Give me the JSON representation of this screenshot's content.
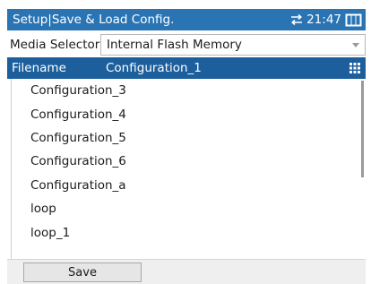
{
  "titlebar": {
    "title": "Setup|Save & Load Config.",
    "time": "21:47",
    "network_icon": "network-transfer-icon",
    "battery_icon": "battery-icon"
  },
  "media_selector": {
    "label": "Media Selector",
    "value": "Internal Flash Memory"
  },
  "filename": {
    "label": "Filename",
    "value": "Configuration_1",
    "keypad_icon": "keypad-icon"
  },
  "files": [
    "Configuration_3",
    "Configuration_4",
    "Configuration_5",
    "Configuration_6",
    "Configuration_a",
    "loop",
    "loop_1"
  ],
  "buttons": {
    "save": "Save"
  },
  "colors": {
    "titlebar": "#2a74b4",
    "filename_row": "#1c5f9c"
  }
}
